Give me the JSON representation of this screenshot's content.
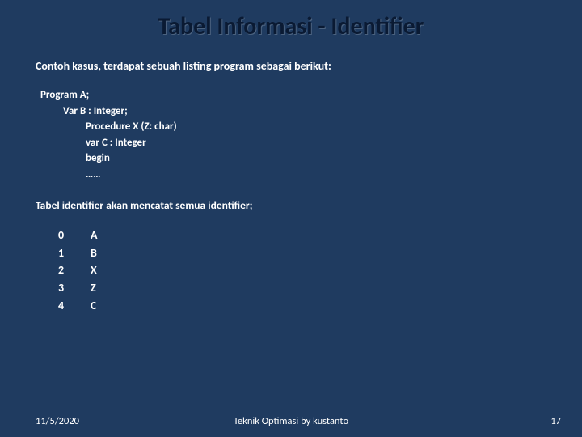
{
  "title": "Tabel Informasi - Identifier",
  "intro": "Contoh kasus, terdapat sebuah listing program sebagai berikut:",
  "code": [
    {
      "indent": 0,
      "text": "Program A;"
    },
    {
      "indent": 1,
      "text": "Var B : Integer;"
    },
    {
      "indent": 2,
      "text": "Procedure  X (Z: char)"
    },
    {
      "indent": 2,
      "text": "var C : Integer"
    },
    {
      "indent": 2,
      "text": "begin"
    },
    {
      "indent": 2,
      "text": "……"
    }
  ],
  "note": "Tabel identifier akan mencatat semua identifier;",
  "table": [
    {
      "idx": "0",
      "val": "A"
    },
    {
      "idx": "1",
      "val": "B"
    },
    {
      "idx": "2",
      "val": "X"
    },
    {
      "idx": "3",
      "val": "Z"
    },
    {
      "idx": "4",
      "val": "C"
    }
  ],
  "footer": {
    "date": "11/5/2020",
    "center": "Teknik Optimasi by kustanto",
    "page": "17"
  }
}
